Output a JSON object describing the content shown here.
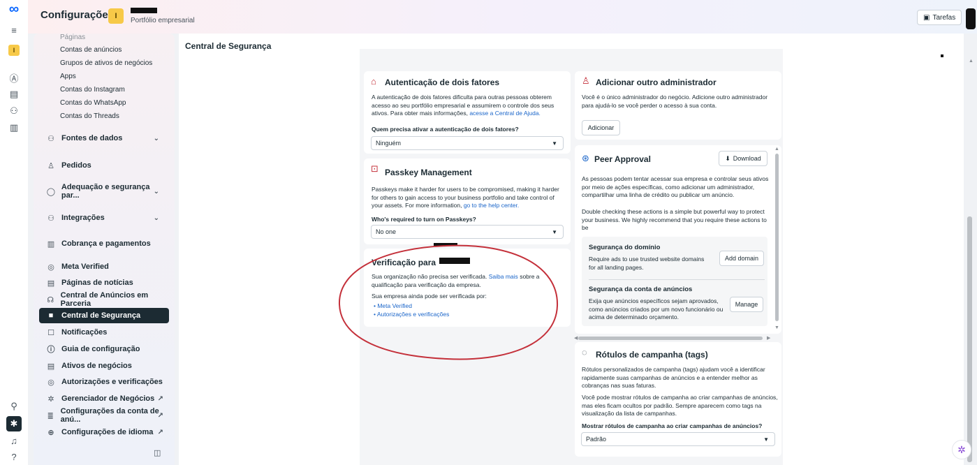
{
  "app": {
    "title": "Configurações",
    "business_sub": "Portfólio empresarial",
    "business_initial": "I",
    "tasks_label": "Tarefas"
  },
  "rail": {
    "business_initial": "I"
  },
  "sidebar": {
    "sub_items": [
      "Páginas",
      "Contas de anúncios",
      "Grupos de ativos de negócios",
      "Apps",
      "Contas do Instagram",
      "Contas do WhatsApp",
      "Contas do Threads"
    ],
    "items": [
      {
        "label": "Fontes de dados"
      },
      {
        "label": "Pedidos"
      },
      {
        "label": "Adequação e segurança par..."
      },
      {
        "label": "Integrações"
      },
      {
        "label": "Cobrança e pagamentos"
      },
      {
        "label": "Meta Verified"
      },
      {
        "label": "Páginas de notícias"
      },
      {
        "label": "Central de Anúncios em Parceria"
      },
      {
        "label": "Central de Segurança"
      },
      {
        "label": "Notificações"
      },
      {
        "label": "Guia de configuração"
      },
      {
        "label": "Ativos de negócios"
      },
      {
        "label": "Autorizações e verificações"
      },
      {
        "label": "Gerenciador de Negócios"
      },
      {
        "label": "Configurações da conta de anú..."
      },
      {
        "label": "Configurações de idioma"
      }
    ]
  },
  "page": {
    "title": "Central de Segurança"
  },
  "two_factor": {
    "title": "Autenticação de dois fatores",
    "desc": "A autenticação de dois fatores dificulta para outras pessoas obterem acesso ao seu portfólio empresarial e assumirem o controle dos seus ativos. Para obter mais informações,",
    "link": "acesse a Central de Ajuda.",
    "question": "Quem precisa ativar a autenticação de dois fatores?",
    "value": "Ninguém"
  },
  "passkey": {
    "title": "Passkey Management",
    "desc": "Passkeys make it harder for users to be compromised, making it harder for others to gain access to your business portfolio and take control of your assets. For more information,",
    "link": "go to the help center.",
    "question": "Who's required to turn on Passkeys?",
    "value": "No one"
  },
  "verification": {
    "title": "Verificação para",
    "desc_pre": "Sua organização não precisa ser verificada.",
    "desc_link": "Saiba mais",
    "desc_post": "sobre a qualificação para verificação da empresa.",
    "still": "Sua empresa ainda pode ser verificada por:",
    "options": [
      "Meta Verified",
      "Autorizações e verificações"
    ]
  },
  "add_admin": {
    "title": "Adicionar outro administrador",
    "desc": "Você é o único administrador do negócio. Adicione outro administrador para ajudá-lo se você perder o acesso à sua conta.",
    "button": "Adicionar"
  },
  "peer": {
    "title": "Peer Approval",
    "download": "Download",
    "desc1": "As pessoas podem tentar acessar sua empresa e controlar seus ativos por meio de ações específicas, como adicionar um administrador, compartilhar uma linha de crédito ou publicar um anúncio.",
    "desc2": "Double checking these actions is a simple but powerful way to protect your business. We highly recommend that you require these actions to be",
    "domain_title": "Segurança do domínio",
    "domain_desc": "Require ads to use trusted website domains for all landing pages.",
    "domain_btn": "Add domain",
    "ads_title": "Segurança da conta de anúncios",
    "ads_desc": "Exija que anúncios específicos sejam aprovados, como anúncios criados por um novo funcionário ou acima de determinado orçamento.",
    "ads_btn": "Manage"
  },
  "labels": {
    "title": "Rótulos de campanha (tags)",
    "desc1": "Rótulos personalizados de campanha (tags) ajudam você a identificar rapidamente suas campanhas de anúncios e a entender melhor as cobranças nas suas faturas.",
    "desc2": "Você pode mostrar rótulos de campanha ao criar campanhas de anúncios, mas eles ficam ocultos por padrão. Sempre aparecem como tags na visualização da lista de campanhas.",
    "question": "Mostrar rótulos de campanha ao criar campanhas de anúncios?",
    "value": "Padrão"
  },
  "colors": {
    "accent": "#0866ff",
    "link": "#1a65c9",
    "active_nav": "#1c2b33",
    "annotation": "#c4303a"
  }
}
